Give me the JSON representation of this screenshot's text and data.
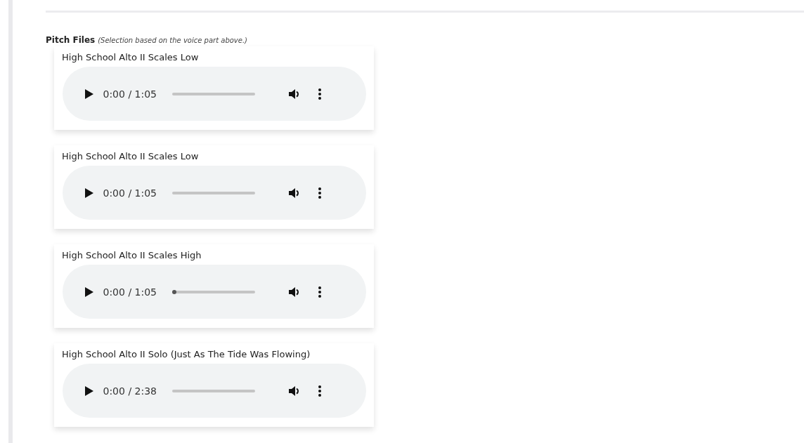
{
  "section": {
    "title": "Pitch Files",
    "note": "(Selection based on the voice part above.)"
  },
  "files": [
    {
      "title": "High School Alto II Scales Low",
      "time": "0:00 / 1:05",
      "thumb_visible": false
    },
    {
      "title": "High School Alto II Scales Low",
      "time": "0:00 / 1:05",
      "thumb_visible": false
    },
    {
      "title": "High School Alto II Scales High",
      "time": "0:00 / 1:05",
      "thumb_visible": true
    },
    {
      "title": "High School Alto II Solo (Just As The Tide Was Flowing)",
      "time": "0:00 / 2:38",
      "thumb_visible": false
    }
  ]
}
